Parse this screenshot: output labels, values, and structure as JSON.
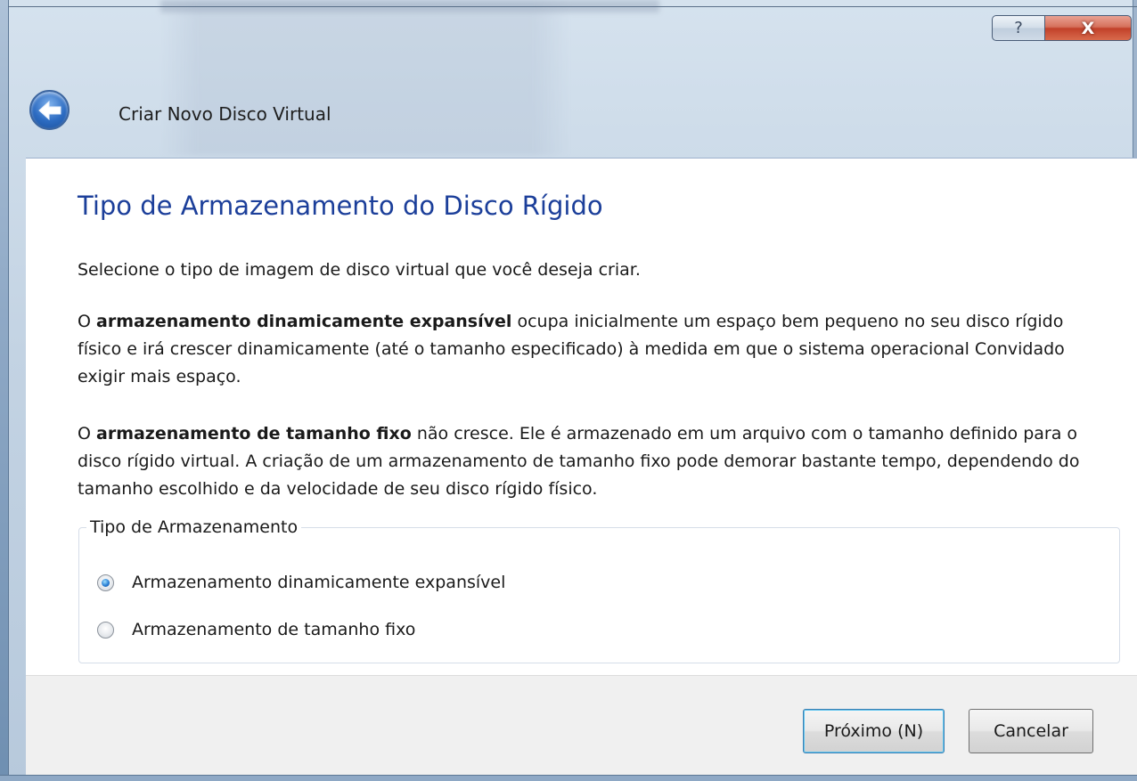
{
  "window": {
    "title": "Criar Novo Disco Virtual",
    "help_label": "?",
    "close_label": "X"
  },
  "page": {
    "heading": "Tipo de Armazenamento do Disco Rígido",
    "intro": "Selecione o tipo de imagem de disco virtual que você deseja criar.",
    "dynamic_prefix": "O ",
    "dynamic_bold": "armazenamento dinamicamente expansível",
    "dynamic_rest": " ocupa inicialmente um espaço bem pequeno no seu disco rígido físico e irá crescer dinamicamente (até o tamanho especificado) à medida em que o sistema operacional Convidado exigir mais espaço.",
    "fixed_prefix": "O ",
    "fixed_bold": "armazenamento de tamanho fixo",
    "fixed_rest": " não cresce. Ele é armazenado em um arquivo com o tamanho definido para o disco rígido virtual. A criação de um armazenamento de tamanho fixo pode demorar bastante tempo, dependendo do tamanho escolhido e da velocidade de seu disco rígido físico."
  },
  "storage_group": {
    "legend": "Tipo de Armazenamento",
    "options": [
      {
        "label": "Armazenamento dinamicamente expansível",
        "checked": true
      },
      {
        "label": "Armazenamento de tamanho fixo",
        "checked": false
      }
    ]
  },
  "footer": {
    "next_label": "Próximo (N)",
    "cancel_label": "Cancelar"
  },
  "colors": {
    "heading": "#1c3f9a",
    "close_button": "#c2412a",
    "back_button": "#2d6cc2"
  }
}
